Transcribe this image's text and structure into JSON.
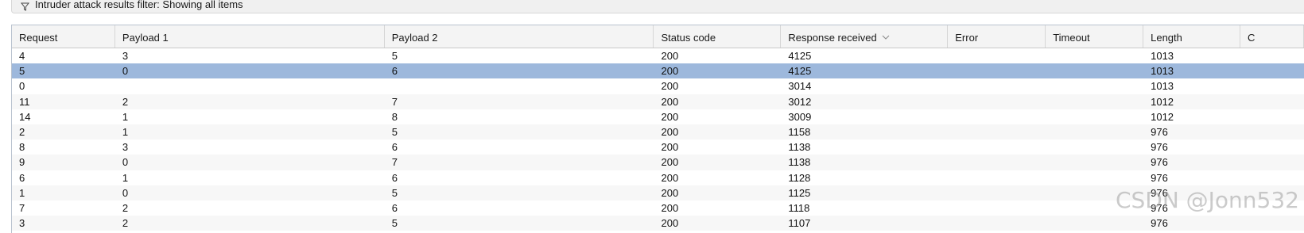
{
  "filter_bar": {
    "icon": "filter-icon",
    "text": "Intruder attack results filter: Showing all items"
  },
  "table": {
    "columns": [
      "Request",
      "Payload 1",
      "Payload 2",
      "Status code",
      "Response received",
      "Error",
      "Timeout",
      "Length",
      "C"
    ],
    "sort_column": "Response received",
    "sort_icon": "chevron-down-icon",
    "selected_row_index": 1,
    "selection_color": "#9db8dc",
    "rows": [
      [
        "4",
        "3",
        "5",
        "200",
        "4125",
        "",
        "",
        "1013",
        ""
      ],
      [
        "5",
        "0",
        "6",
        "200",
        "4125",
        "",
        "",
        "1013",
        ""
      ],
      [
        "0",
        "",
        "",
        "200",
        "3014",
        "",
        "",
        "1013",
        ""
      ],
      [
        "11",
        "2",
        "7",
        "200",
        "3012",
        "",
        "",
        "1012",
        ""
      ],
      [
        "14",
        "1",
        "8",
        "200",
        "3009",
        "",
        "",
        "1012",
        ""
      ],
      [
        "2",
        "1",
        "5",
        "200",
        "1158",
        "",
        "",
        "976",
        ""
      ],
      [
        "8",
        "3",
        "6",
        "200",
        "1138",
        "",
        "",
        "976",
        ""
      ],
      [
        "9",
        "0",
        "7",
        "200",
        "1138",
        "",
        "",
        "976",
        ""
      ],
      [
        "6",
        "1",
        "6",
        "200",
        "1128",
        "",
        "",
        "976",
        ""
      ],
      [
        "1",
        "0",
        "5",
        "200",
        "1125",
        "",
        "",
        "976",
        ""
      ],
      [
        "7",
        "2",
        "6",
        "200",
        "1118",
        "",
        "",
        "976",
        ""
      ],
      [
        "3",
        "2",
        "5",
        "200",
        "1107",
        "",
        "",
        "976",
        ""
      ]
    ]
  },
  "watermark": "CSDN @Jonn532"
}
